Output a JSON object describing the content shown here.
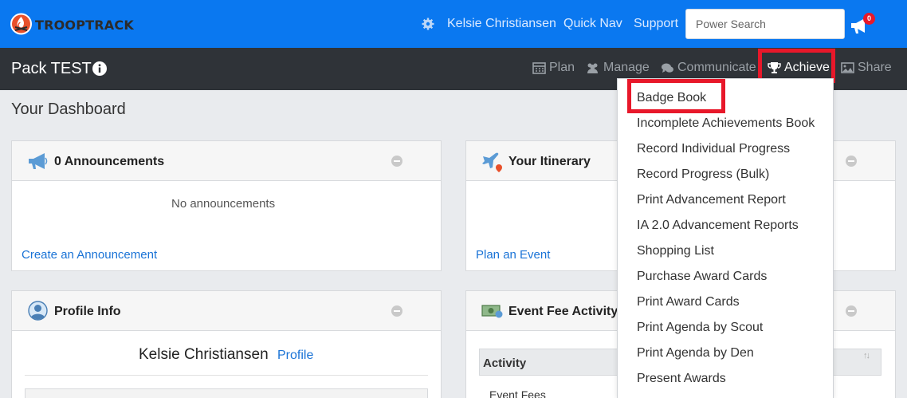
{
  "topbar": {
    "brand": "TROOPTRACK",
    "user_name": "Kelsie Christiansen",
    "quick_nav": "Quick Nav",
    "support": "Support",
    "search_placeholder": "Power Search",
    "notification_count": "0",
    "colors": {
      "bar": "#0a78f0",
      "badge": "#e8182a"
    }
  },
  "subbar": {
    "unit_name": "Pack TEST",
    "nav": {
      "plan": "Plan",
      "manage": "Manage",
      "communicate": "Communicate",
      "achieve": "Achieve",
      "share": "Share"
    }
  },
  "page": {
    "title": "Your Dashboard"
  },
  "panels": {
    "announcements": {
      "title": "0 Announcements",
      "empty_text": "No announcements",
      "link": "Create an Announcement"
    },
    "itinerary": {
      "title": "Your Itinerary",
      "link": "Plan an Event"
    },
    "profile": {
      "title": "Profile Info",
      "name": "Kelsie Christiansen",
      "link": "Profile"
    },
    "event_fees": {
      "title": "Event Fee Activity",
      "column_activity": "Activity",
      "first_row": "Event Fees"
    }
  },
  "achieve_menu": {
    "items": [
      "Badge Book",
      "Incomplete Achievements Book",
      "Record Individual Progress",
      "Record Progress (Bulk)",
      "Print Advancement Report",
      "IA 2.0 Advancement Reports",
      "Shopping List",
      "Purchase Award Cards",
      "Print Award Cards",
      "Print Agenda by Scout",
      "Print Agenda by Den",
      "Present Awards"
    ],
    "highlight_color": "#e8182a"
  }
}
